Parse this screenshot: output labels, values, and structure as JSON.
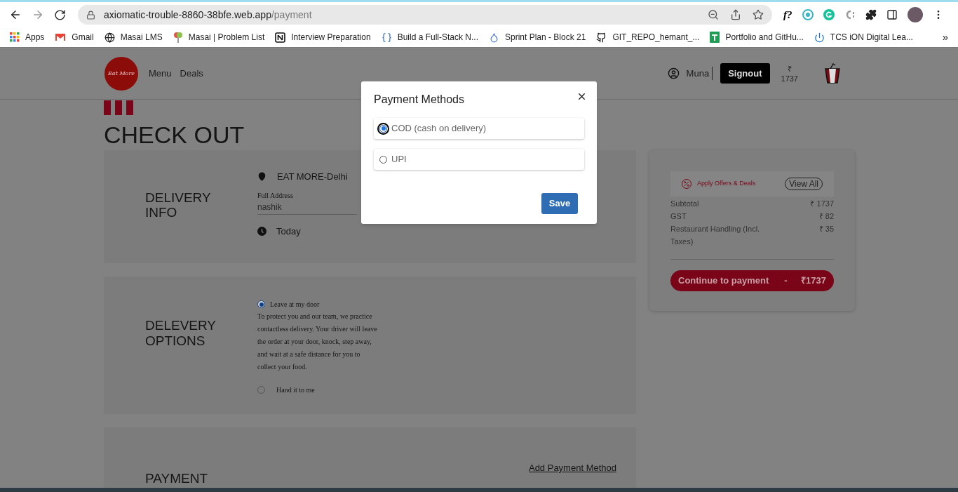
{
  "browser": {
    "url": {
      "domain": "axiomatic-trouble-8860-38bfe.web.app",
      "path": "/payment"
    },
    "extension_text": "f?",
    "bookmarks": [
      {
        "label": "Apps",
        "kind": "apps"
      },
      {
        "label": "Gmail",
        "kind": "gmail"
      },
      {
        "label": "Masai LMS",
        "kind": "globe"
      },
      {
        "label": "Masai | Problem List",
        "kind": "balloon"
      },
      {
        "label": "Interview Preparation",
        "kind": "notion"
      },
      {
        "label": "Build a Full-Stack N...",
        "kind": "braces"
      },
      {
        "label": "Sprint Plan - Block 21",
        "kind": "drop"
      },
      {
        "label": "GIT_REPO_hemant_...",
        "kind": "github"
      },
      {
        "label": "Portfolio and GitHu...",
        "kind": "sheet"
      },
      {
        "label": "TCS iON Digital Lea...",
        "kind": "power"
      }
    ],
    "overflow": "»"
  },
  "header": {
    "logo_text": "Eat More",
    "nav": [
      "Menu",
      "Deals"
    ],
    "user": "Muna",
    "signout": "Signout",
    "cart_currency": "₹",
    "cart_total": "1737"
  },
  "title": "CHECK OUT",
  "delivery_info": {
    "heading": "DELIVERY INFO",
    "location": "EAT MORE-Delhi",
    "address_label": "Full Address",
    "address_value": "nashik",
    "time": "Today"
  },
  "delivery_options": {
    "heading": "DELEVERY OPTIONS",
    "options": [
      {
        "label": "Leave at my door",
        "selected": true,
        "description": "To protect you and our team, we practice contactless delivery. Your driver will leave the order at your door, knock, step away, and wait at a safe distance for you to collect your food."
      },
      {
        "label": "Hand it to me",
        "selected": false
      }
    ]
  },
  "payment": {
    "heading": "PAYMENT",
    "link": "Add Payment Method"
  },
  "summary": {
    "offers": "Apply Offers & Deals",
    "view_all": "View All",
    "lines": [
      {
        "label": "Subtotal",
        "amount": "₹ 1737"
      },
      {
        "label": "GST",
        "amount": "₹ 82"
      },
      {
        "label": "Restaurant Handling (Incl. Taxes)",
        "amount": "₹ 35"
      }
    ],
    "button": {
      "label": "Continue to payment",
      "separator": "-",
      "amount": "₹1737"
    }
  },
  "modal": {
    "title": "Payment Methods",
    "options": [
      {
        "label": "COD (cash on delivery)",
        "selected": true
      },
      {
        "label": "UPI",
        "selected": false
      }
    ],
    "save": "Save"
  }
}
